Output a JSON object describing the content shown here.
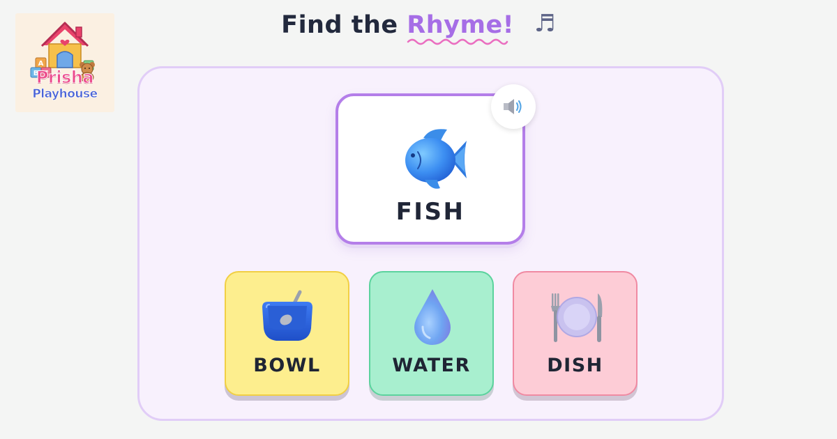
{
  "logo": {
    "line1": "Prisha",
    "line2": "Playhouse",
    "block_letters": [
      "A",
      "B",
      "C"
    ]
  },
  "title": {
    "prefix": "Find the",
    "highlight": "Rhyme!",
    "icon": "music-notes-icon"
  },
  "target": {
    "word": "FISH",
    "icon": "fish-icon",
    "audio_icon": "speaker-icon"
  },
  "options": [
    {
      "label": "BOWL",
      "icon": "bowl-icon",
      "color": "#fdee8e"
    },
    {
      "label": "WATER",
      "icon": "water-drop-icon",
      "color": "#a8efcf"
    },
    {
      "label": "DISH",
      "icon": "plate-icon",
      "color": "#fdccd6"
    }
  ],
  "colors": {
    "accent": "#a66ee6",
    "background": "#f4f5f4",
    "board": "#f8f1fd",
    "target_border": "#b47ee9"
  }
}
